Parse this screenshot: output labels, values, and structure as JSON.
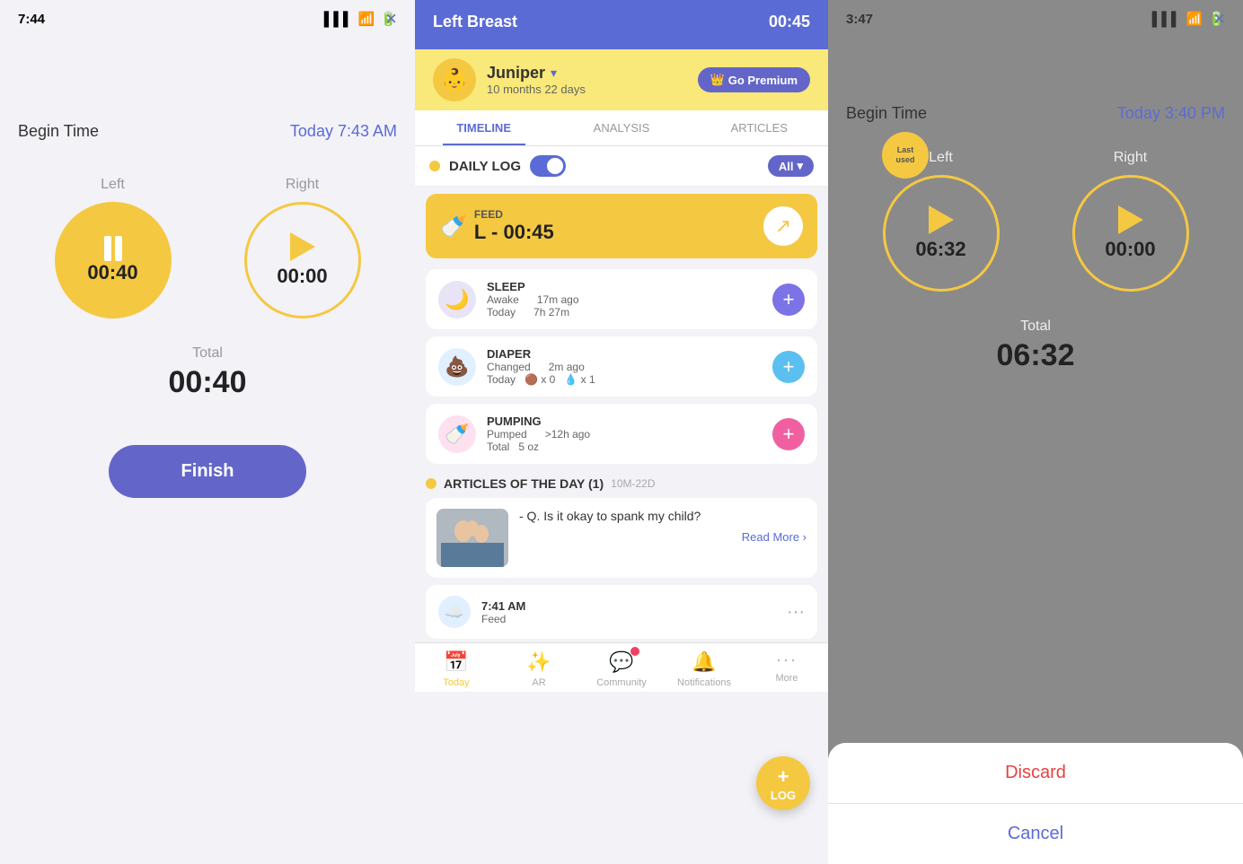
{
  "panel1": {
    "statusbar": {
      "time": "7:44",
      "close_label": "×"
    },
    "begin_time_label": "Begin Time",
    "begin_time_value": "Today 7:43 AM",
    "left_label": "Left",
    "right_label": "Right",
    "left_time": "00:40",
    "right_time": "00:00",
    "total_label": "Total",
    "total_time": "00:40",
    "finish_label": "Finish"
  },
  "panel2": {
    "header": {
      "title": "Left Breast",
      "timer": "00:45"
    },
    "profile": {
      "name": "Juniper",
      "age": "10 months 22 days",
      "premium_label": "Go Premium"
    },
    "tabs": [
      "TIMELINE",
      "ANALYSIS",
      "ARTICLES"
    ],
    "active_tab": "TIMELINE",
    "daily_log_label": "DAILY LOG",
    "all_label": "All",
    "feed": {
      "label": "FEED",
      "value": "L - 00:45"
    },
    "sleep": {
      "title": "SLEEP",
      "status": "Awake",
      "time_ago": "17m ago",
      "date": "Today",
      "duration": "7h 27m"
    },
    "diaper": {
      "title": "DIAPER",
      "status": "Changed",
      "time_ago": "2m ago",
      "date": "Today",
      "poop": "🟤 x 0",
      "wet": "💧 x 1"
    },
    "pumping": {
      "title": "PUMPING",
      "status": "Pumped",
      "time_ago": ">12h ago",
      "total_label": "Total",
      "total_value": "5 oz"
    },
    "articles": {
      "title": "ARTICLES OF THE DAY (1)",
      "date_tag": "10M-22D",
      "question": "- Q. Is it okay to spank my child?",
      "read_more": "Read More ›"
    },
    "timeline": {
      "time": "7:41 AM",
      "label": "Feed"
    },
    "log_label": "LOG",
    "nav": {
      "items": [
        {
          "label": "Today",
          "icon": "📅",
          "active": true
        },
        {
          "label": "AR",
          "icon": "✨",
          "active": false
        },
        {
          "label": "Community",
          "icon": "💬",
          "active": false,
          "badge": true
        },
        {
          "label": "Notifications",
          "icon": "🔔",
          "active": false
        },
        {
          "label": "More",
          "icon": "···",
          "active": false
        }
      ]
    }
  },
  "panel3": {
    "statusbar": {
      "time": "3:47",
      "close_label": "×"
    },
    "begin_time_label": "Begin Time",
    "begin_time_value": "Today 3:40 PM",
    "last_used_label": "Last\nused",
    "left_label": "Left",
    "right_label": "Right",
    "left_time": "06:32",
    "right_time": "00:00",
    "total_label": "Total",
    "total_time": "06:32",
    "discard_label": "Discard",
    "cancel_label": "Cancel"
  }
}
